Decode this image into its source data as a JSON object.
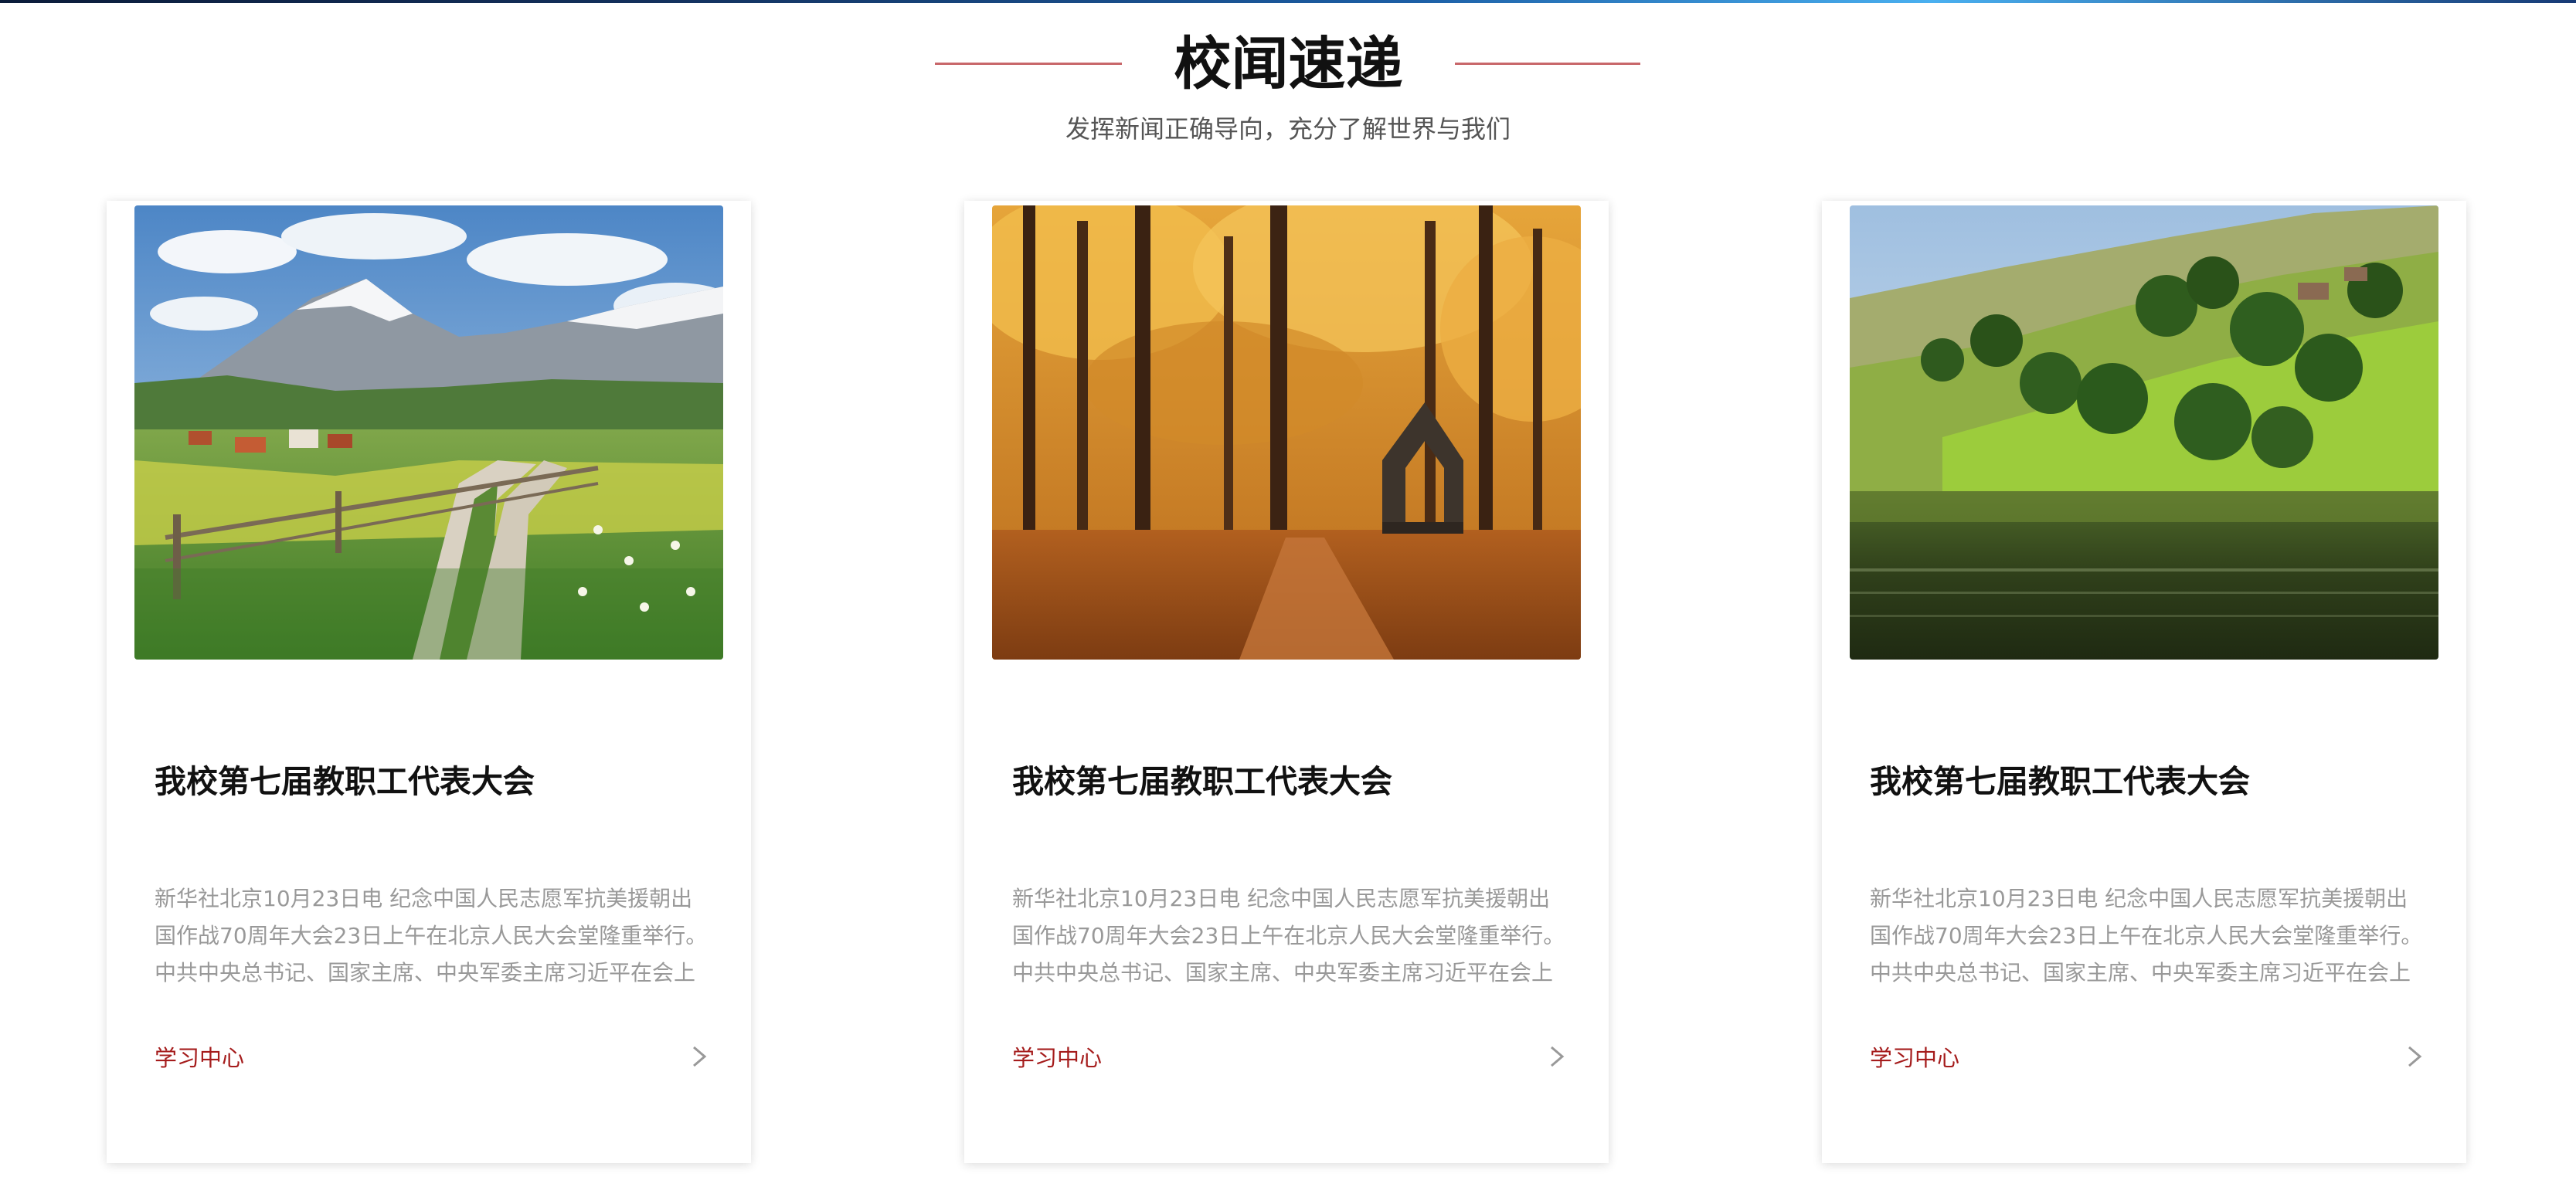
{
  "header": {
    "title": "校闻速递",
    "subtitle": "发挥新闻正确导向，充分了解世界与我们"
  },
  "cards": [
    {
      "title": "我校第七届教职工代表大会",
      "excerpt": "新华社北京10月23日电 纪念中国人民志愿军抗美援朝出国作战70周年大会23日上午在北京人民大会堂隆重举行。中共中央总书记、国家主席、中央军委主席习近平在会上",
      "link": "学习中心",
      "image": "alpine-valley-path-photo",
      "arrow_icon": "chevron-right-icon"
    },
    {
      "title": "我校第七届教职工代表大会",
      "excerpt": "新华社北京10月23日电 纪念中国人民志愿军抗美援朝出国作战70周年大会23日上午在北京人民大会堂隆重举行。中共中央总书记、国家主席、中央军委主席习近平在会上",
      "link": "学习中心",
      "image": "autumn-forest-stone-arch-photo",
      "arrow_icon": "chevron-right-icon"
    },
    {
      "title": "我校第七届教职工代表大会",
      "excerpt": "新华社北京10月23日电 纪念中国人民志愿军抗美援朝出国作战70周年大会23日上午在北京人民大会堂隆重举行。中共中央总书记、国家主席、中央军委主席习近平在会上",
      "link": "学习中心",
      "image": "green-hills-lake-photo",
      "arrow_icon": "chevron-right-icon"
    }
  ],
  "colors": {
    "accent": "#a51c1c",
    "title_line": "#c8676a",
    "title_text": "#111111",
    "excerpt_text": "#999999"
  }
}
